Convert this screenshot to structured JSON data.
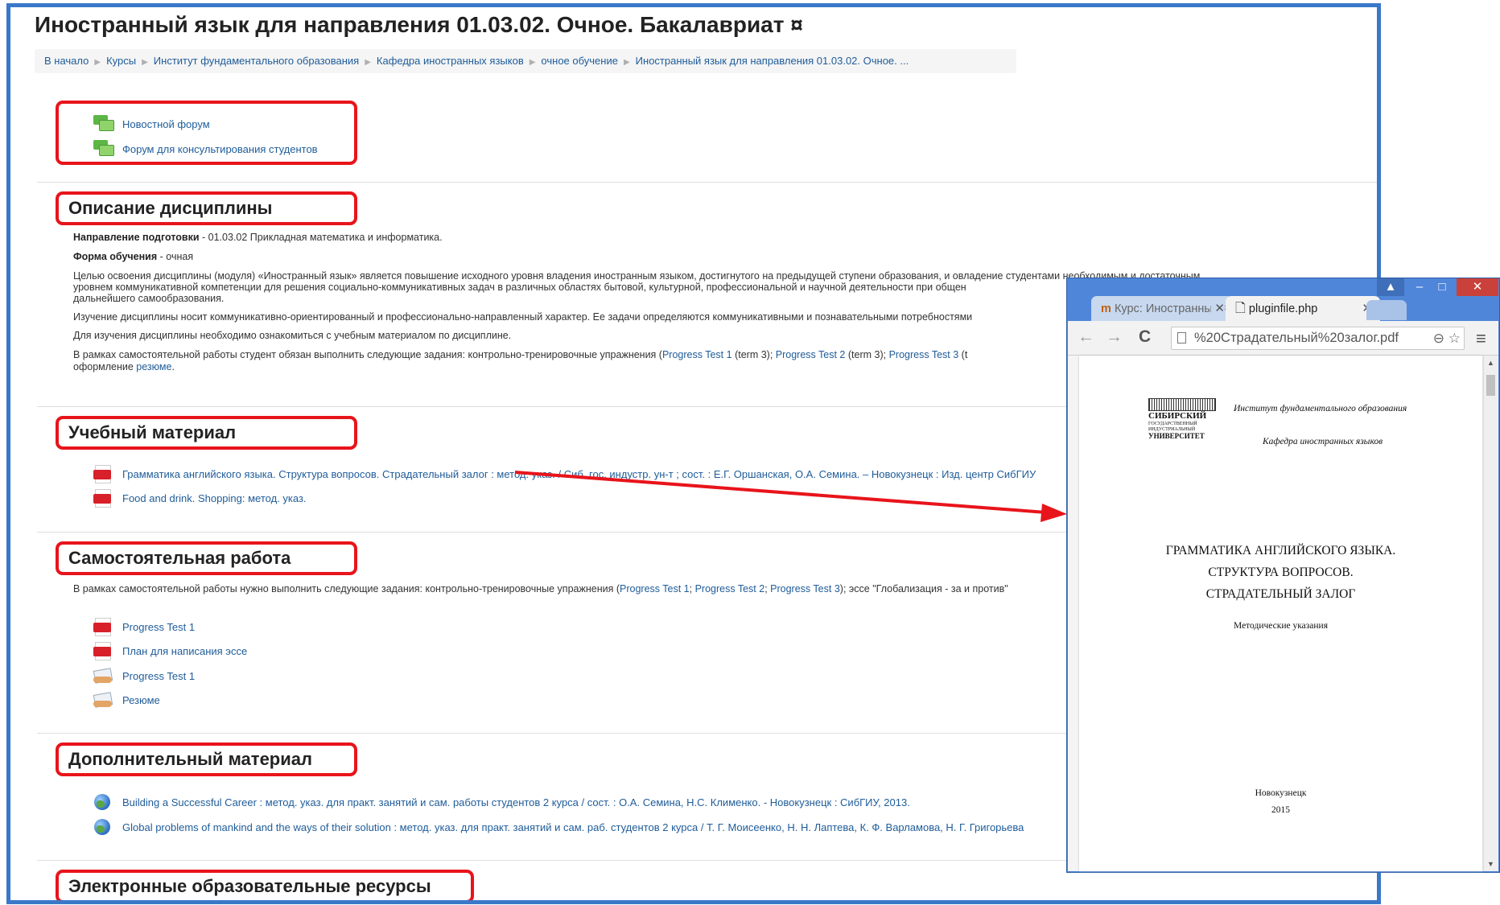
{
  "page": {
    "title": "Иностранный язык для направления 01.03.02. Очное. Бакалавриат ¤",
    "breadcrumb": [
      "В начало",
      "Курсы",
      "Институт фундаментального образования",
      "Кафедра иностранных языков",
      "очное обучение",
      "Иностранный язык для направления 01.03.02. Очное. ..."
    ]
  },
  "forums": [
    {
      "name": "Новостной форум",
      "icon": "forum-icon"
    },
    {
      "name": "Форум для консультирования студентов",
      "icon": "forum-icon"
    }
  ],
  "description": {
    "title": "Описание дисциплины",
    "direction_label": "Направление подготовки",
    "direction_value": " - 01.03.02 Прикладная математика и информатика.",
    "form_label": "Форма обучения",
    "form_value": " - очная",
    "goal_line1": "Целью освоения дисциплины (модуля) «Иностранный язык» является повышение исходного уровня владения иностранным языком, достигнутого на предыдущей ступени образования, и овладение студентами необходимым и достаточным",
    "goal_line2": "уровнем коммуникативной компетенции для решения социально-коммуникативных задач в различных областях бытовой, культурной, профессиональной и научной деятельности при общен",
    "goal_line3": "дальнейшего самообразования.",
    "character": "Изучение дисциплины носит коммуникативно-ориентированный и профессионально-направленный характер. Ее задачи определяются коммуникативными и познавательными потребностями",
    "study": "Для изучения дисциплины необходимо ознакомиться с учебным материалом по дисциплине.",
    "self_prefix": "В рамках самостоятельной работы студент обязан выполнить следующие задания: контрольно-тренировочные упражнения (",
    "self_links": [
      "Progress Test 1",
      "Progress Test 2",
      "Progress Test 3"
    ],
    "self_terms": [
      " (term 3); ",
      " (term 3); ",
      " (t"
    ],
    "self_line2_prefix": "оформление ",
    "self_line2_link": "резюме",
    "self_line2_suffix": "."
  },
  "material": {
    "title": "Учебный материал",
    "items": [
      {
        "name": "Грамматика английского языка. Структура вопросов. Страдательный залог : метод. указ. / Сиб. гос. индустр. ун-т ; сост. : Е.Г. Оршанская, О.А. Семина. – Новокузнецк : Изд. центр СибГИУ",
        "icon": "pdf-icon"
      },
      {
        "name": "Food and drink. Shopping: метод. указ.",
        "icon": "pdf-icon"
      }
    ]
  },
  "selfwork": {
    "title": "Самостоятельная работа",
    "text_prefix": "В рамках самостоятельной работы нужно выполнить следующие задания: контрольно-тренировочные упражнения (",
    "links": [
      "Progress Test 1",
      "Progress Test 2",
      "Progress Test 3"
    ],
    "text_suffix": "); эссе \"Глобализация - за и против\"",
    "items": [
      {
        "name": "Progress Test 1",
        "icon": "pdf-icon"
      },
      {
        "name": "План для написания эссе",
        "icon": "pdf-icon"
      },
      {
        "name": "Progress Test 1",
        "icon": "assignment-icon"
      },
      {
        "name": "Резюме",
        "icon": "assignment-icon"
      }
    ]
  },
  "extra": {
    "title": "Дополнительный материал",
    "items": [
      {
        "name": "Building a Successful Career : метод. указ. для практ. занятий и сам. работы студентов 2 курса / сост. : О.А. Семина, Н.С. Клименко. - Новокузнецк : СибГИУ, 2013.",
        "icon": "globe-icon"
      },
      {
        "name": "Global problems of mankind and the ways of their solution : метод. указ. для практ. занятий и сам. раб. студентов 2 курса / Т. Г. Моисеенко, Н. Н. Лаптева, К. Ф. Варламова, Н. Г. Григорьева",
        "icon": "globe-icon"
      }
    ]
  },
  "eresources": {
    "title": "Электронные образовательные ресурсы"
  },
  "browser": {
    "tab1": "Курс: Иностранный язык",
    "tab2": "pluginfile.php",
    "url": "%20Страдательный%20залог.pdf",
    "colors": {
      "frame": "#4f86d9",
      "close": "#c9413a"
    },
    "pdf": {
      "institute": "Институт фундаментального образования",
      "department": "Кафедра иностранных языков",
      "logo_lines": [
        "СИБИРСКИЙ",
        "ГОСУДАРСТВЕННЫЙ",
        "ИНДУСТРИАЛЬНЫЙ",
        "УНИВЕРСИТЕТ"
      ],
      "title_lines": [
        "ГРАММАТИКА АНГЛИЙСКОГО ЯЗЫКА.",
        "СТРУКТУРА ВОПРОСОВ.",
        "СТРАДАТЕЛЬНЫЙ ЗАЛОГ"
      ],
      "subtitle": "Методические указания",
      "city": "Новокузнецк",
      "year": "2015"
    }
  },
  "colors": {
    "accent_border": "#3a78c9",
    "highlight": "#e8141b",
    "link": "#1f5c99"
  }
}
